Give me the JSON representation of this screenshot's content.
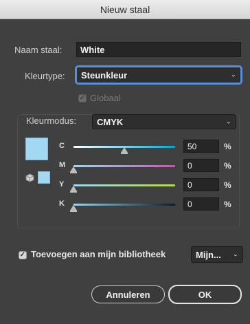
{
  "dialog": {
    "title": "Nieuw staal"
  },
  "name": {
    "label": "Naam staal:",
    "value": "White"
  },
  "colortype": {
    "label": "Kleurtype:",
    "value": "Steunkleur"
  },
  "global": {
    "label": "Globaal",
    "checked": true,
    "disabled": true
  },
  "colormode": {
    "label": "Kleurmodus:",
    "value": "CMYK"
  },
  "preview": {
    "fill": "#a3d8f4",
    "secondary_fill": "#a3d8f4"
  },
  "sliders": [
    {
      "channel": "C",
      "value": "50",
      "unit": "%",
      "level": 0.5,
      "track": "linear-gradient(90deg,#ffffff,#00a6d6)"
    },
    {
      "channel": "M",
      "value": "0",
      "unit": "%",
      "level": 0,
      "track": "linear-gradient(90deg,#9fd6f2,#c05bb0)"
    },
    {
      "channel": "Y",
      "value": "0",
      "unit": "%",
      "level": 0,
      "track": "linear-gradient(90deg,#9fd6f2,#b7d84e)"
    },
    {
      "channel": "K",
      "value": "0",
      "unit": "%",
      "level": 0,
      "track": "linear-gradient(90deg,#9fd6f2,#0e1a22)"
    }
  ],
  "library": {
    "label": "Toevoegen aan mijn bibliotheek",
    "checked": true,
    "select_value": "Mijn..."
  },
  "buttons": {
    "cancel": "Annuleren",
    "ok": "OK"
  }
}
